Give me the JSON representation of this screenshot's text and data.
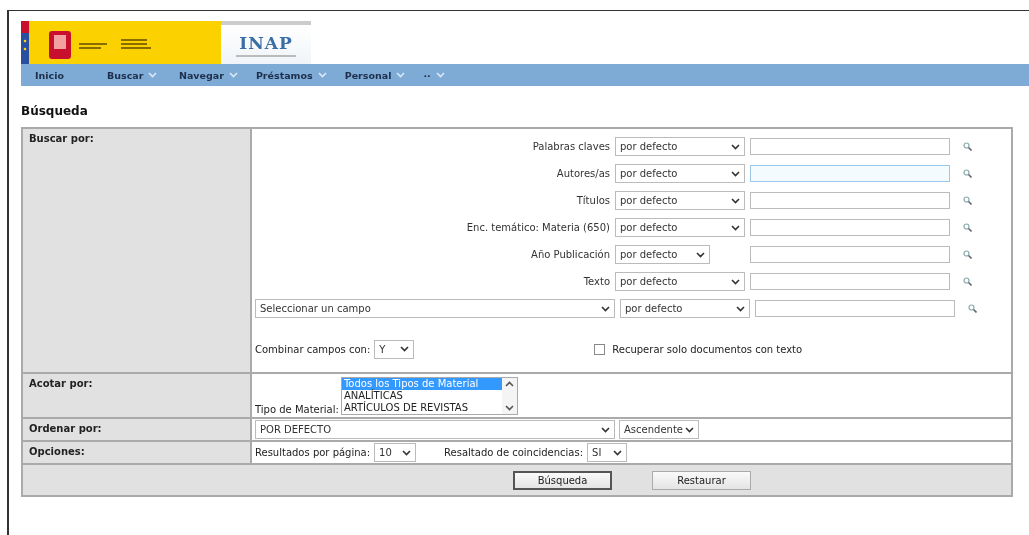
{
  "header": {
    "logo_text": "INAP"
  },
  "nav": [
    {
      "label": "Inicio",
      "has_menu": false
    },
    {
      "label": "Buscar",
      "has_menu": true
    },
    {
      "label": "Navegar",
      "has_menu": true
    },
    {
      "label": "Préstamos",
      "has_menu": true
    },
    {
      "label": "Personal",
      "has_menu": true
    },
    {
      "label": "··",
      "has_menu": true
    }
  ],
  "page_title": "Búsqueda",
  "sections": [
    {
      "label": "Buscar por:"
    },
    {
      "label": "Acotar por:"
    },
    {
      "label": "Ordenar por:"
    },
    {
      "label": "Opciones:"
    }
  ],
  "search_fields": [
    {
      "kind": "labeled",
      "label": "Palabras claves",
      "mode": "por defecto",
      "compact": false,
      "focused": false
    },
    {
      "kind": "labeled",
      "label": "Autores/as",
      "mode": "por defecto",
      "compact": false,
      "focused": true
    },
    {
      "kind": "labeled",
      "label": "Títulos",
      "mode": "por defecto",
      "compact": false,
      "focused": false
    },
    {
      "kind": "labeled",
      "label": "Enc. temático: Materia (650)",
      "mode": "por defecto",
      "compact": false,
      "focused": false
    },
    {
      "kind": "labeled",
      "label": "Año Publicación",
      "mode": "por defecto",
      "compact": true,
      "focused": false
    },
    {
      "kind": "labeled",
      "label": "Texto",
      "mode": "por defecto",
      "compact": false,
      "focused": false
    },
    {
      "kind": "chooser",
      "field": "Seleccionar un campo",
      "mode": "por defecto",
      "compact": false,
      "focused": false
    }
  ],
  "combine": {
    "label": "Combinar campos con:",
    "value": "Y"
  },
  "full_text_only": {
    "label": "Recuperar solo documentos con texto",
    "checked": false
  },
  "material": {
    "label": "Tipo de Material:",
    "options": [
      {
        "label": "Todos los Tipos de Material",
        "selected": true
      },
      {
        "label": "ANALÍTICAS",
        "selected": false
      },
      {
        "label": "ARTÍCULOS DE REVISTAS",
        "selected": false
      }
    ]
  },
  "sort": {
    "field": "POR DEFECTO",
    "order": "Ascendente"
  },
  "options": {
    "per_page_label": "Resultados por página:",
    "per_page": "10",
    "highlight_label": "Resaltado de coincidencias:",
    "highlight": "SI"
  },
  "buttons": [
    {
      "label": "Búsqueda",
      "default": true
    },
    {
      "label": "Restaurar",
      "default": false
    }
  ]
}
